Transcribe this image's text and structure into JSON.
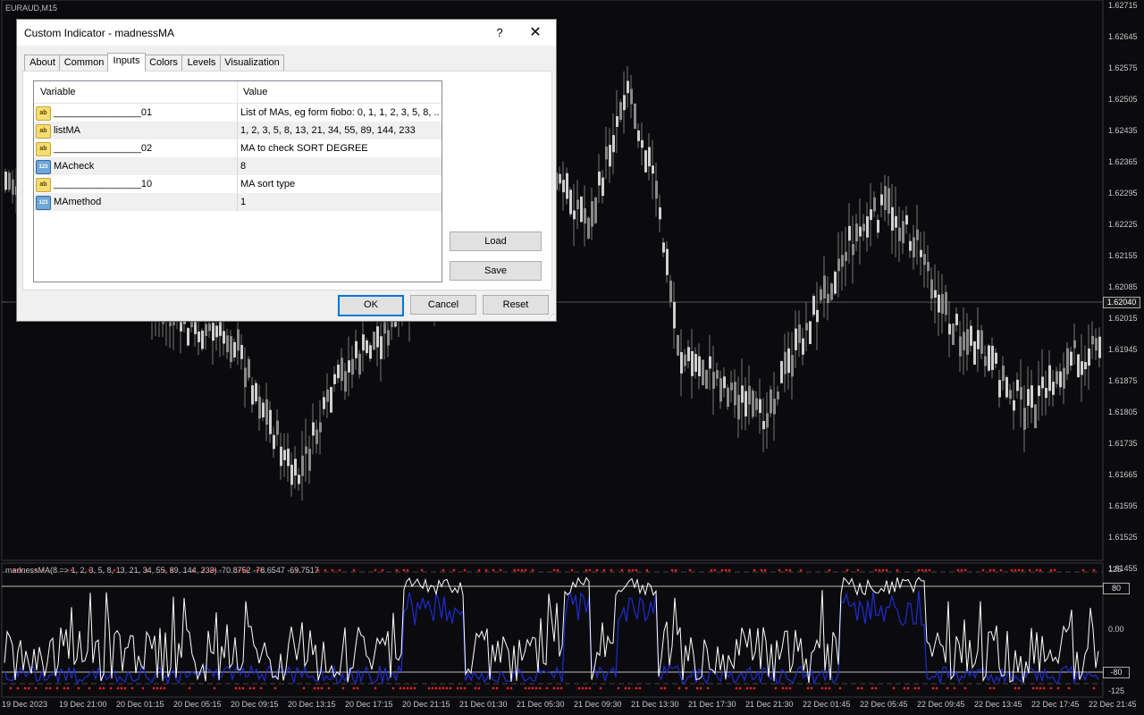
{
  "chart": {
    "symbol": "EURAUD,M15",
    "price_labels": [
      "1.62715",
      "1.62645",
      "1.62575",
      "1.62505",
      "1.62435",
      "1.62365",
      "1.62295",
      "1.62225",
      "1.62155",
      "1.62085",
      "1.62015",
      "1.61945",
      "1.61875",
      "1.61805",
      "1.61735",
      "1.61665",
      "1.61595",
      "1.61525",
      "1.61455"
    ],
    "current_price": "1.62040",
    "time_labels": [
      "19 Dec 2023",
      "19 Dec 21:00",
      "20 Dec 01:15",
      "20 Dec 05:15",
      "20 Dec 09:15",
      "20 Dec 13:15",
      "20 Dec 17:15",
      "20 Dec 21:15",
      "21 Dec 01:30",
      "21 Dec 05:30",
      "21 Dec 09:30",
      "21 Dec 13:30",
      "21 Dec 17:30",
      "21 Dec 21:30",
      "22 Dec 01:45",
      "22 Dec 05:45",
      "22 Dec 09:45",
      "22 Dec 13:45",
      "22 Dec 17:45",
      "22 Dec 21:45"
    ]
  },
  "indicator": {
    "label": "madnessMA(8 => 1, 2, 3, 5, 8, 13, 21, 34, 55, 89, 144, 233) -70.8752 -78.6547 -69.7517",
    "levels": {
      "top": "125",
      "upper": "80",
      "zero": "0.00",
      "lower": "-80",
      "bottom": "-125"
    }
  },
  "dialog": {
    "title": "Custom Indicator - madnessMA",
    "help": "?",
    "close": "✕",
    "tabs": [
      "About",
      "Common",
      "Inputs",
      "Colors",
      "Levels",
      "Visualization"
    ],
    "active_tab": "Inputs",
    "columns": {
      "variable": "Variable",
      "value": "Value"
    },
    "rows": [
      {
        "icon": "ab",
        "name": "________________01",
        "value": "List of MAs, eg form fiobo: 0, 1, 1, 2, 3, 5, 8, ..."
      },
      {
        "icon": "ab",
        "name": "listMA",
        "value": "1, 2, 3, 5, 8, 13, 21, 34, 55, 89, 144, 233"
      },
      {
        "icon": "ab",
        "name": "________________02",
        "value": "MA to check SORT DEGREE"
      },
      {
        "icon": "123",
        "name": "MAcheck",
        "value": "8"
      },
      {
        "icon": "ab",
        "name": "________________10",
        "value": "MA sort type"
      },
      {
        "icon": "123",
        "name": "MAmethod",
        "value": "1"
      }
    ],
    "buttons": {
      "load": "Load",
      "save": "Save",
      "ok": "OK",
      "cancel": "Cancel",
      "reset": "Reset"
    }
  }
}
